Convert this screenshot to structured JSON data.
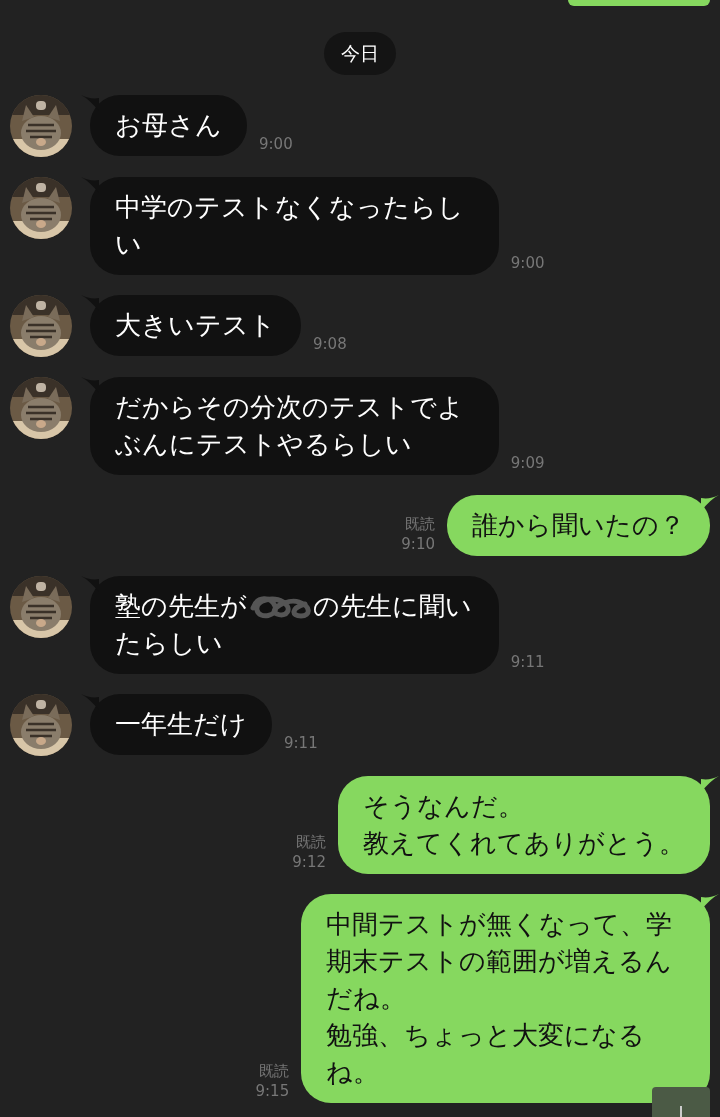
{
  "date_label": "今日",
  "messages": [
    {
      "kind": "cut-off"
    },
    {
      "kind": "incoming",
      "lines": [
        "お母さん"
      ],
      "time": "9:00"
    },
    {
      "kind": "incoming",
      "lines": [
        "中学のテストなくなったらしい"
      ],
      "time": "9:00"
    },
    {
      "kind": "incoming",
      "lines": [
        "大きいテスト"
      ],
      "time": "9:08"
    },
    {
      "kind": "incoming",
      "lines": [
        "だからその分次のテストでよぶんにテストやるらしい"
      ],
      "time": "9:09"
    },
    {
      "kind": "outgoing",
      "lines": [
        "誰から聞いたの？"
      ],
      "time": "9:10",
      "read": "既読"
    },
    {
      "kind": "incoming",
      "segments": [
        {
          "kind": "text",
          "text": "塾の先生が"
        },
        {
          "kind": "scribble"
        },
        {
          "kind": "text",
          "text": "の先生に聞いたらしい"
        }
      ],
      "time": "9:11"
    },
    {
      "kind": "incoming",
      "lines": [
        "一年生だけ"
      ],
      "time": "9:11"
    },
    {
      "kind": "outgoing",
      "lines": [
        "そうなんだ。",
        "教えてくれてありがとう。"
      ],
      "time": "9:12",
      "read": "既読"
    },
    {
      "kind": "outgoing",
      "lines": [
        "中間テストが無くなって、学期末テストの範囲が増えるんだね。",
        "勉強、ちょっと大変になるね。"
      ],
      "time": "9:15",
      "read": "既読"
    }
  ]
}
